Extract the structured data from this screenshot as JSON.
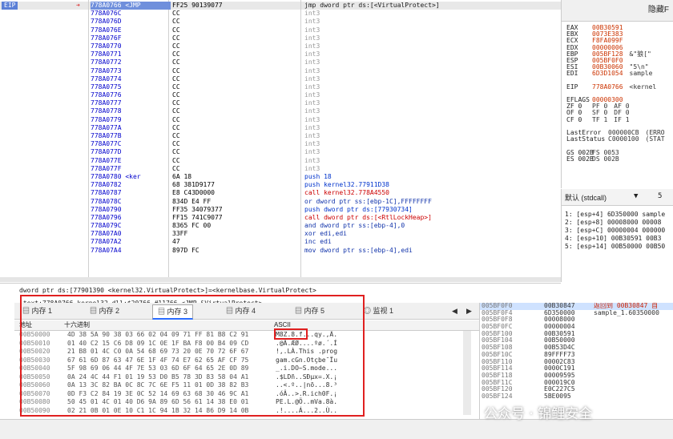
{
  "disasm": {
    "eip_label": "EIP",
    "addresses": [
      "778A0766 <JMP",
      "778A076C",
      "778A076D",
      "778A076E",
      "778A076F",
      "778A0770",
      "778A0771",
      "778A0772",
      "778A0773",
      "778A0774",
      "778A0775",
      "778A0776",
      "778A0777",
      "778A0778",
      "778A0779",
      "778A077A",
      "778A077B",
      "778A077C",
      "778A077D",
      "778A077E",
      "778A077F",
      "778A0780 <ker",
      "778A0782",
      "778A0787",
      "778A078C",
      "778A0790",
      "778A0796",
      "778A079C",
      "778A07A0",
      "778A07A2",
      "778A07A4"
    ],
    "bytes": [
      "FF25 90139077",
      "CC",
      "CC",
      "CC",
      "CC",
      "CC",
      "CC",
      "CC",
      "CC",
      "CC",
      "CC",
      "CC",
      "CC",
      "CC",
      "CC",
      "CC",
      "CC",
      "CC",
      "CC",
      "CC",
      "CC",
      "6A 18",
      "68 381D9177",
      "E8 C43D0000",
      "834D E4 FF",
      "FF35 34079377",
      "FF15 741C9077",
      "8365 FC 00",
      "33FF",
      "47",
      "897D FC"
    ],
    "asm": [
      "jmp dword ptr ds:[<VirtualProtect>]",
      "int3",
      "int3",
      "int3",
      "int3",
      "int3",
      "int3",
      "int3",
      "int3",
      "int3",
      "int3",
      "int3",
      "int3",
      "int3",
      "int3",
      "int3",
      "int3",
      "int3",
      "int3",
      "int3",
      "int3",
      "push 18",
      "push kernel32.77911D38",
      "call kernel32.778A4550",
      "or dword ptr ss:[ebp-1C],FFFFFFFF",
      "push dword ptr ds:[77930734]",
      "call dword ptr ds:[<RtlLockHeap>]",
      "and dword ptr ss:[ebp-4],0",
      "xor edi,edi",
      "inc edi",
      "mov dword ptr ss:[ebp-4],edi"
    ]
  },
  "info": {
    "line1": "dword ptr ds:[77901390 <kernel32.VirtualProtect>]=<kernelbase.VirtualProtect>",
    "line2": ".text:778A0766 kernel32.dll:$20766 #11766 <JMP.&VirtualProtect>"
  },
  "registers": {
    "header": "隐藏F",
    "lines": [
      {
        "n": "EAX",
        "v": "00B30591",
        "c": ""
      },
      {
        "n": "EBX",
        "v": "0073E383",
        "c": ""
      },
      {
        "n": "ECX",
        "v": "F8FA099F",
        "c": ""
      },
      {
        "n": "EDX",
        "v": "00000006",
        "c": ""
      },
      {
        "n": "EBP",
        "v": "005BF128",
        "c": "&\"狼[\""
      },
      {
        "n": "ESP",
        "v": "005BF0F0",
        "c": ""
      },
      {
        "n": "ESI",
        "v": "00B30060",
        "c": "\"5\\n\""
      },
      {
        "n": "EDI",
        "v": "6D3D1054",
        "c": "sample"
      },
      {
        "n": "",
        "v": "",
        "c": ""
      },
      {
        "n": "EIP",
        "v": "778A0766",
        "c": "<kernel"
      },
      {
        "n": "",
        "v": "",
        "c": ""
      },
      {
        "n": "EFLAGS",
        "v": "00000300",
        "c": ""
      },
      {
        "n": "ZF 0",
        "v": "PF 0",
        "c": "AF 0"
      },
      {
        "n": "OF 0",
        "v": "SF 0",
        "c": "DF 0"
      },
      {
        "n": "CF 0",
        "v": "TF 1",
        "c": "IF 1"
      },
      {
        "n": "",
        "v": "",
        "c": ""
      },
      {
        "n": "LastError",
        "v": "000000CB",
        "c": "(ERRO"
      },
      {
        "n": "LastStatus",
        "v": "C0000100",
        "c": "(STAT"
      },
      {
        "n": "",
        "v": "",
        "c": ""
      },
      {
        "n": "GS 002B",
        "v": "FS 0053",
        "c": ""
      },
      {
        "n": "ES 002B",
        "v": "DS 002B",
        "c": ""
      }
    ]
  },
  "calls": {
    "dropdown": "默认 (stdcall)",
    "count": "5",
    "items": [
      "1: [esp+4] 6D350000 sample",
      "2: [esp+8] 00008000 00008",
      "3: [esp+C] 00000004 000000",
      "4: [esp+10] 00B30591 00B3",
      "5: [esp+14] 00B50000 00B50"
    ]
  },
  "memory": {
    "tabs": [
      "内存 1",
      "内存 2",
      "内存 3",
      "内存 4",
      "内存 5",
      "监视 1"
    ],
    "header_addr": "地址",
    "header_hex": "十六进制",
    "header_ascii": "ASCII",
    "rows": [
      {
        "a": "00B50000",
        "h": "4D 38 5A 90 38 03 66 02 04 09 71 FF 81 B8 C2 91",
        "s": "M8Z.8.f...qy.,Â."
      },
      {
        "a": "00B50010",
        "h": "01 40 C2 15 C6 D8 09 1C 0E 1F BA F8 00 B4 09 CD",
        "s": ".@Â.ÆØ....ºø.´.Í"
      },
      {
        "a": "00B50020",
        "h": "21 B8 01 4C C0 0A 54 68 69 73 20 0E 70 72 6F 67",
        "s": "!,.LÀ.This .prog"
      },
      {
        "a": "00B50030",
        "h": "67 61 6D 87 63 47 6E 1F 4F 74 E7 62 65 AF CF 75",
        "s": "gam.cGn.Otçbe¯Ïu"
      },
      {
        "a": "00B50040",
        "h": "5F 98 69 06 44 4F 7E 53 03 6D 6F 64 65 2E 0D 89",
        "s": "_.i.DO~S.mode..."
      },
      {
        "a": "00B50050",
        "h": "0A 24 4C 44 F1 01 19 53 D0 B5 78 3D 83 58 04 A1",
        "s": ".$LDñ..SÐµx=.X.¡"
      },
      {
        "a": "00B50060",
        "h": "0A 13 3C 82 BA 0C 8C 7C 6E F5 11 01 0D 38 82 B3",
        "s": "..<.º..|nõ...8.³"
      },
      {
        "a": "00B50070",
        "h": "0D F3 C2 84 19 3E 0C 52 14 69 63 68 30 46 9C A1",
        "s": ".óÂ..>.R.ich0F.¡"
      },
      {
        "a": "00B50080",
        "h": "50 45 01 4C 01 40 D6 9A 89 6D 56 61 14 38 E0 01",
        "s": "PE.L.@Ö..mVa.8à."
      },
      {
        "a": "00B50090",
        "h": "02 21 0B 01 0E 10 C1 1C 94 1B 32 14 86 D9 14 0B",
        "s": ".!....Á...2..Ù.."
      }
    ]
  },
  "stack": {
    "rows": [
      {
        "a": "005BF0F0",
        "v": "00B30847",
        "c": "返回到 00B30847 自"
      },
      {
        "a": "005BF0F4",
        "v": "6D350000",
        "c": "sample_1.60350000"
      },
      {
        "a": "005BF0F8",
        "v": "00008000",
        "c": ""
      },
      {
        "a": "005BF0FC",
        "v": "00000004",
        "c": ""
      },
      {
        "a": "005BF100",
        "v": "00B30591",
        "c": ""
      },
      {
        "a": "005BF104",
        "v": "00B50000",
        "c": ""
      },
      {
        "a": "005BF108",
        "v": "00B53D4C",
        "c": ""
      },
      {
        "a": "005BF10C",
        "v": "89FFFF73",
        "c": ""
      },
      {
        "a": "005BF110",
        "v": "00002C83",
        "c": ""
      },
      {
        "a": "005BF114",
        "v": "0000C191",
        "c": ""
      },
      {
        "a": "005BF118",
        "v": "00009595",
        "c": ""
      },
      {
        "a": "005BF11C",
        "v": "000019C0",
        "c": ""
      },
      {
        "a": "005BF120",
        "v": "E0C227C5",
        "c": ""
      },
      {
        "a": "005BF124",
        "v": "5BE0095",
        "c": ""
      }
    ]
  },
  "watermark": "公众号 · 锦鲤安全"
}
